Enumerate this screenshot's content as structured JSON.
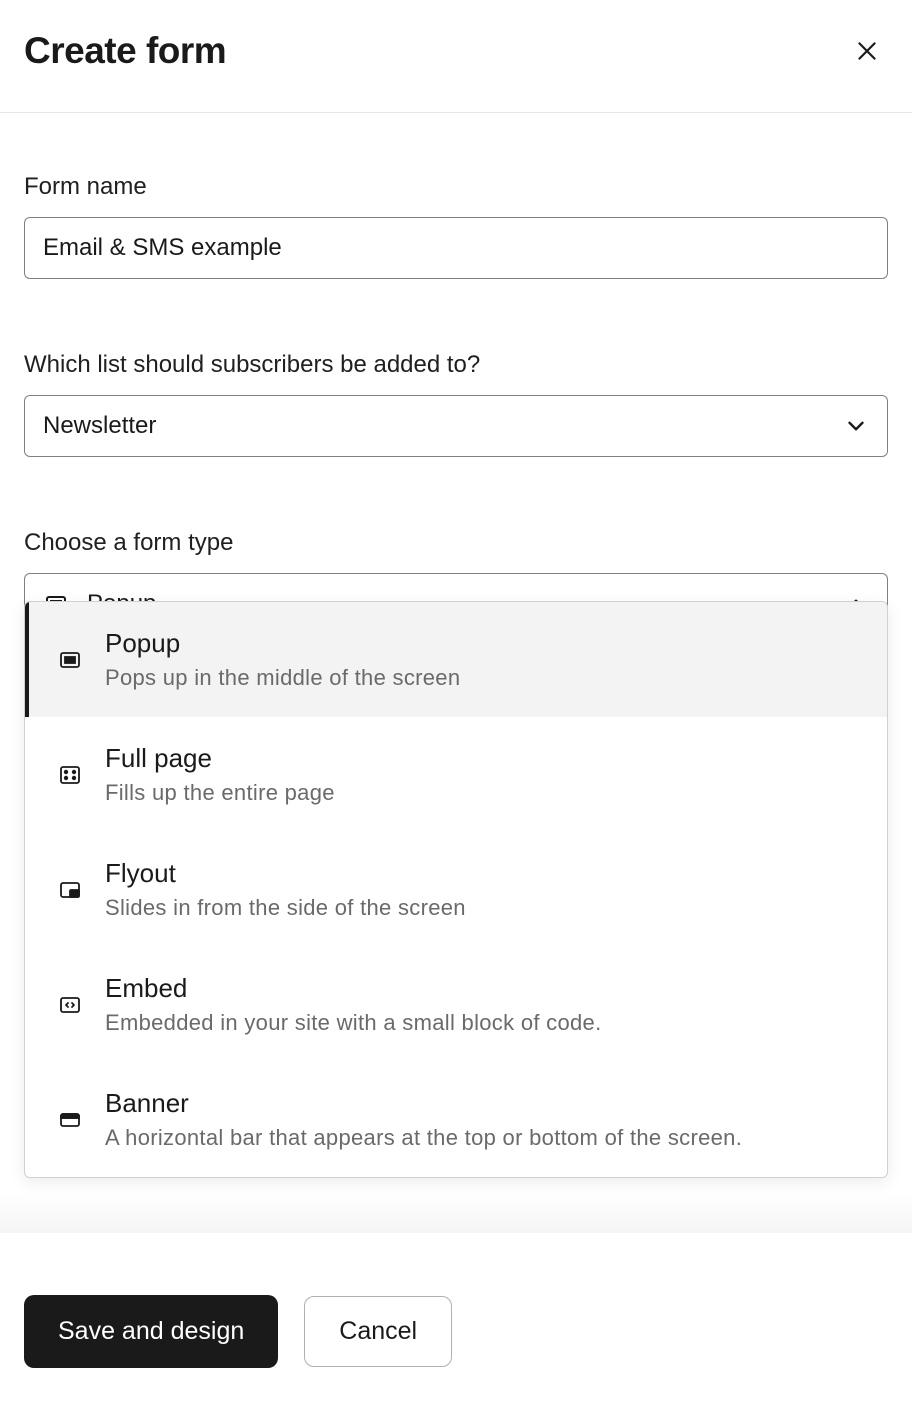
{
  "header": {
    "title": "Create form"
  },
  "fields": {
    "form_name": {
      "label": "Form name",
      "value": "Email & SMS example"
    },
    "list_select": {
      "label": "Which list should subscribers be added to?",
      "value": "Newsletter"
    },
    "form_type": {
      "label": "Choose a form type",
      "value": "Popup",
      "options": [
        {
          "title": "Popup",
          "desc": "Pops up in the middle of the screen",
          "icon": "popup"
        },
        {
          "title": "Full page",
          "desc": "Fills up the entire page",
          "icon": "fullpage"
        },
        {
          "title": "Flyout",
          "desc": "Slides in from the side of the screen",
          "icon": "flyout"
        },
        {
          "title": "Embed",
          "desc": "Embedded in your site with a small block of code.",
          "icon": "embed"
        },
        {
          "title": "Banner",
          "desc": "A horizontal bar that appears at the top or bottom of the screen.",
          "icon": "banner"
        }
      ]
    }
  },
  "footer": {
    "primary": "Save and design",
    "secondary": "Cancel"
  }
}
